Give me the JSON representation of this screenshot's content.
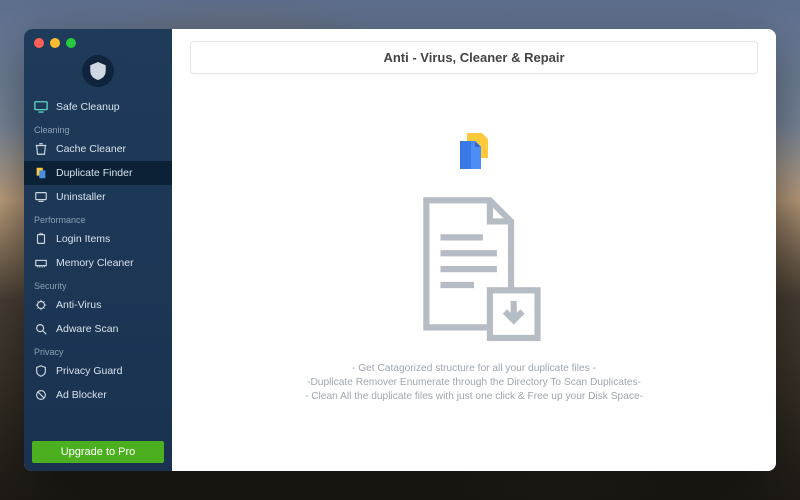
{
  "header": {
    "title": "Anti - Virus, Cleaner & Repair"
  },
  "sidebar": {
    "items": [
      {
        "label": "Safe Cleanup",
        "icon": "monitor-icon",
        "section": null
      },
      {
        "label": "Cache Cleaner",
        "icon": "trash-icon",
        "section": "Cleaning"
      },
      {
        "label": "Duplicate Finder",
        "icon": "files-icon",
        "section": null,
        "active": true
      },
      {
        "label": "Uninstaller",
        "icon": "uninstall-icon",
        "section": null
      },
      {
        "label": "Login Items",
        "icon": "plug-icon",
        "section": "Performance"
      },
      {
        "label": "Memory Cleaner",
        "icon": "ram-icon",
        "section": null
      },
      {
        "label": "Anti-Virus",
        "icon": "virus-icon",
        "section": "Security"
      },
      {
        "label": "Adware Scan",
        "icon": "adware-icon",
        "section": null
      },
      {
        "label": "Privacy Guard",
        "icon": "privacy-icon",
        "section": "Privacy"
      },
      {
        "label": "Ad Blocker",
        "icon": "adblock-icon",
        "section": null
      }
    ],
    "sections": {
      "cleaning": "Cleaning",
      "performance": "Performance",
      "security": "Security",
      "privacy": "Privacy"
    },
    "upgrade_label": "Upgrade to Pro"
  },
  "main": {
    "desc1": "- Get Catagorized structure for all your duplicate files -",
    "desc2": "-Duplicate Remover Enumerate through the Directory To Scan Duplicates-",
    "desc3": "- Clean All the duplicate files with just one click & Free up your Disk Space-"
  }
}
